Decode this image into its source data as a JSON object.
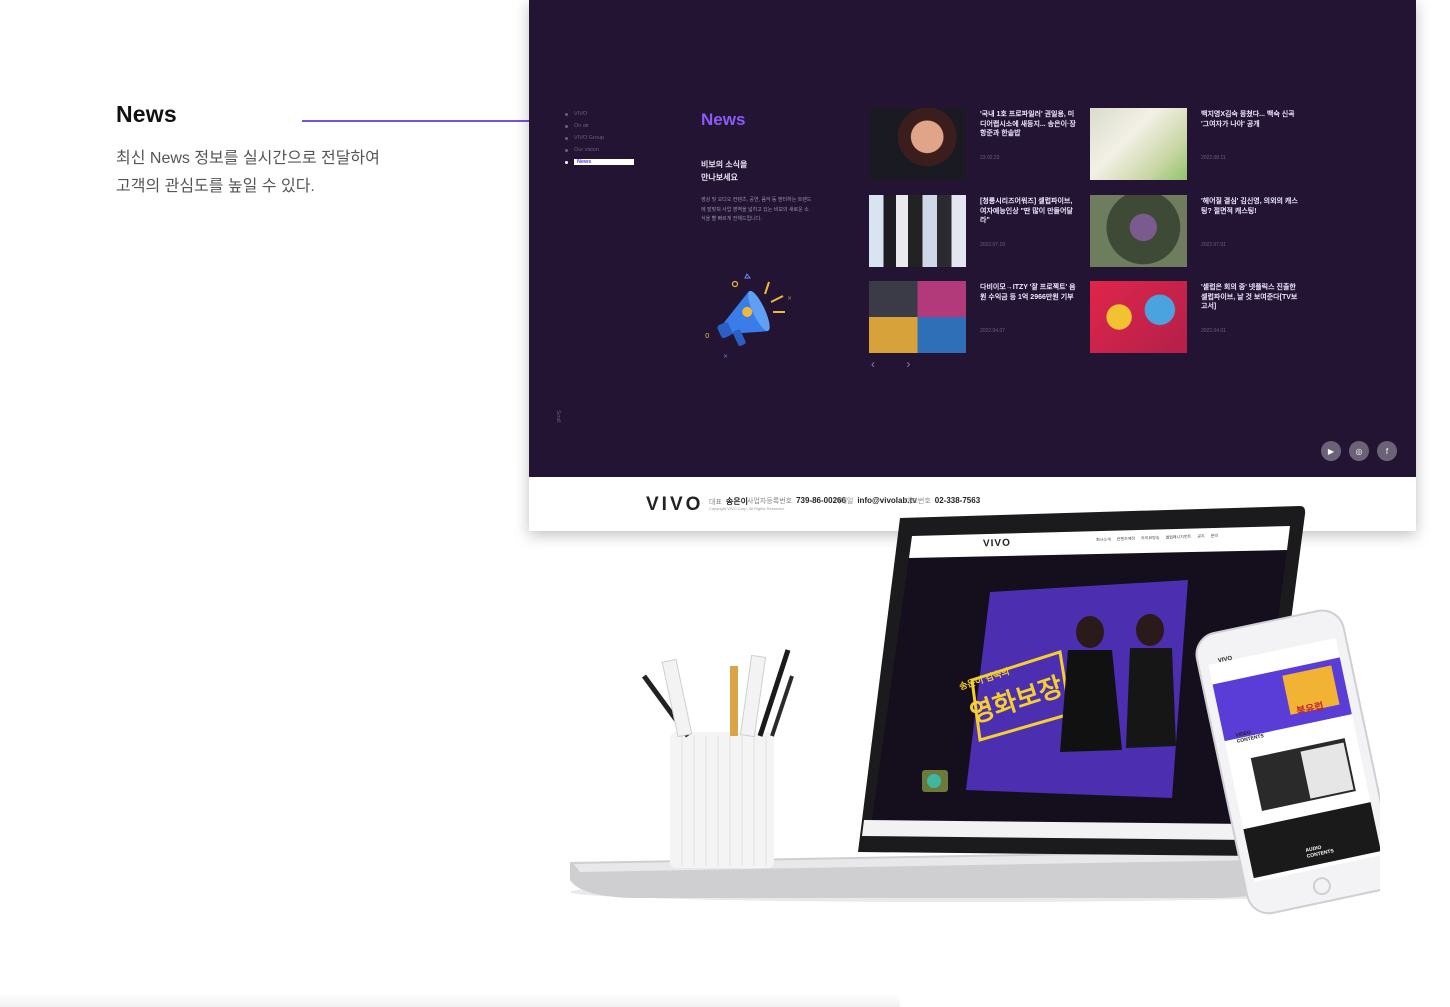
{
  "annotation": {
    "title": "News",
    "desc_line1": "최신 News 정보를 실시간으로 전달하여",
    "desc_line2": "고객의 관심도를 높일 수 있다."
  },
  "site": {
    "side_nav": [
      "VIVO",
      "On air",
      "VIVO Group",
      "Our vision",
      "News"
    ],
    "scroll_label": "Scroll",
    "heading": "News",
    "sub_line1": "비보의 소식을",
    "sub_line2": "만나보세요",
    "body": "영상 및 오디오 컨텐츠, 공연, 음악 등 엔터하는 트렌드에 발맞춰 사업 영역을 넓히고 있는 비보의 새로운 소식을 빨 빠르게 전해드립니다.",
    "news": [
      {
        "title": "'국내 1호 프로파일러' 권일용, 미디어랩시소에 새둥지... 송은이·장항준과 한솥밥",
        "date": "23.02.23"
      },
      {
        "title": "백지영X김숙 뭉쳤다... 백숙 신곡 '그여자가 나야' 공개",
        "date": "2022.08.11"
      },
      {
        "title": "[청룡시리즈어워즈] 셀럽파이브, 여자예능인상 \"딴 많이 만들어달라\"",
        "date": "2022.07.19"
      },
      {
        "title": "'헤어질 결심' 김신영, 의외의 캐스팅? 절면적 캐스팅!",
        "date": "2022.07.01"
      },
      {
        "title": "다비이모→ITZY '잘 프로젝트' 음원 수익금 등 1억 2966만원 기부",
        "date": "2022.04.07"
      },
      {
        "title": "'셀럽은 회의 중' 넷플릭스 진출한 셀럽파이브, 날 것 보여준다[TV보고서]",
        "date": "2022.04.01"
      }
    ],
    "arrows": "‹ ›",
    "social": [
      "▶",
      "◎",
      "f"
    ],
    "footer": {
      "logo": "VIVO",
      "ceo_label": "대표",
      "ceo": "송은이",
      "biz_label": "사업자등록번호",
      "biz": "739-86-00266",
      "email_label": "이메일",
      "email": "info@vivolab.tv",
      "tel_label": "대표번호",
      "tel": "02-338-7563",
      "copyright": "Copyright VIVO Corp. All Rights Reserved."
    }
  },
  "laptop": {
    "logo": "VIVO",
    "nav": [
      "회사소개",
      "컨텐츠제작",
      "라이브방송",
      "셀럽매니지먼트",
      "공지",
      "문의"
    ],
    "poster_small": "송은이 김숙의",
    "poster_big": "영화보장"
  },
  "phone": {
    "logo": "VIVO",
    "tag": "북유럽",
    "video_label_1": "VIDEO",
    "video_label_2": "CONTENTS",
    "audio_label_1": "AUDIO",
    "audio_label_2": "CONTENTS"
  },
  "colors": {
    "accent": "#7b4fe0",
    "site_bg": "#221432",
    "news_heading": "#8a5cf6"
  }
}
